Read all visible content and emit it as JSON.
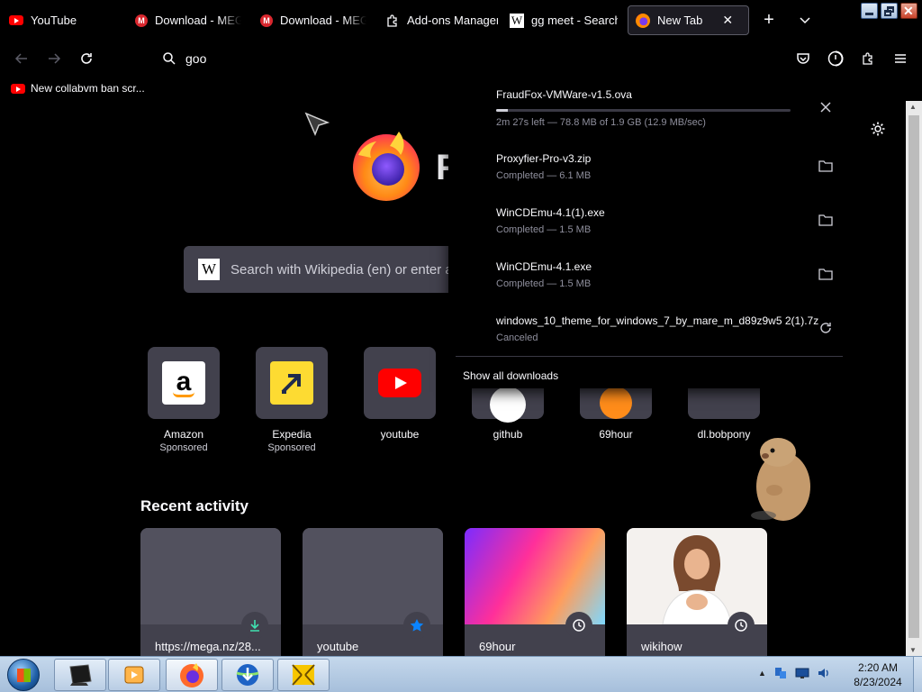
{
  "tabs": [
    {
      "title": "YouTube",
      "icon": "youtube-icon"
    },
    {
      "title": "Download - MEGA",
      "icon": "mega-icon"
    },
    {
      "title": "Download - MEGA",
      "icon": "mega-icon"
    },
    {
      "title": "Add-ons Manager",
      "icon": "puzzle-icon"
    },
    {
      "title": "gg meet - Search",
      "icon": "wikipedia-icon"
    },
    {
      "title": "New Tab",
      "icon": "firefox-icon",
      "active": true
    }
  ],
  "toolbar": {
    "url_value": "goo"
  },
  "bookmarks": [
    {
      "label": "New collabvm ban scr...",
      "icon": "youtube-icon"
    }
  ],
  "newtab": {
    "search_placeholder": "Search with Wikipedia (en) or enter address",
    "tiles": [
      {
        "label": "Amazon",
        "sub": "Sponsored",
        "icon": "amazon-icon"
      },
      {
        "label": "Expedia",
        "sub": "Sponsored",
        "icon": "expedia-icon"
      },
      {
        "label": "youtube",
        "sub": "",
        "icon": "youtube-icon"
      },
      {
        "label": "github",
        "sub": "",
        "icon": "github-icon"
      },
      {
        "label": "69hour",
        "sub": "",
        "icon": "site-icon"
      },
      {
        "label": "dl.bobpony",
        "sub": "",
        "icon": "site-icon"
      }
    ],
    "recent_title": "Recent activity",
    "recent": [
      {
        "label": "https://mega.nz/28...",
        "badge": "download-icon"
      },
      {
        "label": "youtube",
        "badge": "star-icon"
      },
      {
        "label": "69hour",
        "badge": "clock-icon"
      },
      {
        "label": "wikihow",
        "badge": "clock-icon"
      }
    ]
  },
  "downloads": {
    "items": [
      {
        "name": "FraudFox-VMWare-v1.5.ova",
        "status": "2m 27s left — 78.8 MB of 1.9 GB (12.9 MB/sec)",
        "progress": 0.04,
        "action": "cancel-icon"
      },
      {
        "name": "Proxyfier-Pro-v3.zip",
        "status": "Completed — 6.1 MB",
        "action": "folder-icon"
      },
      {
        "name": "WinCDEmu-4.1(1).exe",
        "status": "Completed — 1.5 MB",
        "action": "folder-icon"
      },
      {
        "name": "WinCDEmu-4.1.exe",
        "status": "Completed — 1.5 MB",
        "action": "folder-icon"
      },
      {
        "name": "windows_10_theme_for_windows_7_by_mare_m_d89z9w5 2(1).7z",
        "status": "Canceled",
        "action": "retry-icon"
      }
    ],
    "show_all": "Show all downloads"
  },
  "taskbar": {
    "time": "2:20 AM",
    "date": "8/23/2024"
  }
}
